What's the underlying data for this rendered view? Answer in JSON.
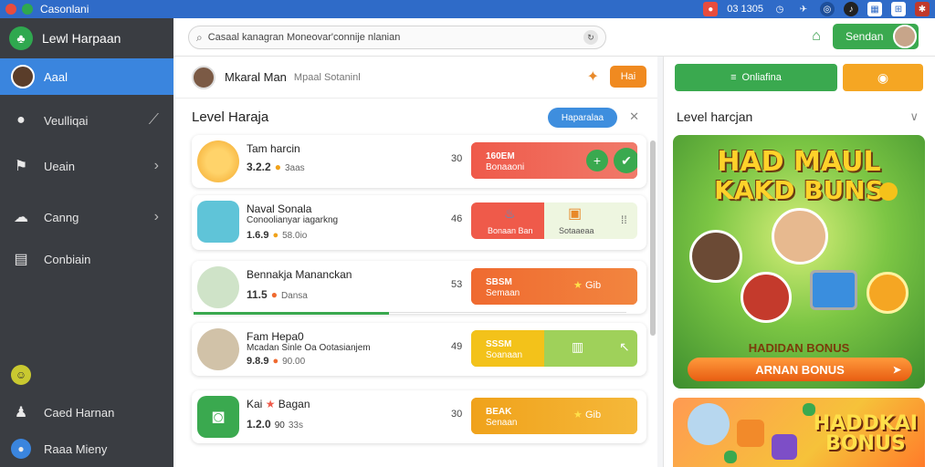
{
  "titlebar": {
    "title": "Casonlani",
    "time": "03 1305"
  },
  "sidebar": {
    "title": "Lewl Harpaan",
    "items": [
      {
        "label": "Aaal",
        "icon": "avatar"
      },
      {
        "label": "Veulliqai",
        "icon": "apple-icon"
      },
      {
        "label": "Ueain",
        "icon": "flag-icon"
      },
      {
        "label": "Canng",
        "icon": "cloud-icon"
      },
      {
        "label": "Conbiain",
        "icon": "document-icon"
      }
    ],
    "bottom": [
      {
        "label": "Caed Harnan",
        "icon": "user-icon"
      },
      {
        "label": "Raaa Mieny",
        "icon": "globe-icon"
      }
    ]
  },
  "topbar": {
    "search_value": "Casaal kanagran Moneovar'connije nlanian",
    "send_label": "Sendan"
  },
  "profile": {
    "name": "Mkaral Man",
    "subtitle": "Mpaal Sotaninl",
    "button": "Hai"
  },
  "list": {
    "title": "Level Haraja",
    "button": "Haparalaa",
    "rows": [
      {
        "name": "Tam harcin",
        "sub": "",
        "stat": "3.2.2",
        "small": "3aas",
        "num": "30",
        "p1": "160EM",
        "p2": "Bonaaoni",
        "color": "#ef5a4a",
        "fill": 0.7,
        "act": "+",
        "act2": "check"
      },
      {
        "name": "Naval Sonala",
        "sub": "Conoolianyar iagarkng",
        "stat": "1.6.9",
        "small": "58.0io",
        "num": "46",
        "p1": "",
        "p2": "Bonaan Ban",
        "color": "#ef5a4a",
        "fill": 0.45,
        "mid": "Sotaaeaa",
        "act": "",
        "act2": ""
      },
      {
        "name": "Bennakja Mananckan",
        "sub": "",
        "stat": "11.5",
        "small": "Dansa",
        "num": "53",
        "p1": "SBSM",
        "p2": "Semaan",
        "color": "#ef6a30",
        "fill": 0.9,
        "mid": "Gib",
        "act": "",
        "act2": ""
      },
      {
        "name": "Fam Hepa0",
        "sub": "Mcadan Sinle Oa Ootasianjem",
        "stat": "9.8.9",
        "small": "90.00",
        "num": "49",
        "p1": "SSSM",
        "p2": "Soanaan",
        "color": "#f3c21a",
        "fill": 0.45,
        "mid": "",
        "act": "",
        "act2": ""
      },
      {
        "name": "Kai",
        "sub": "Bagan",
        "stat": "1.2.0",
        "small": "33s",
        "num": "30",
        "p1": "BEAK",
        "p2": "Senaan",
        "color": "#f0a21b",
        "fill": 0.9,
        "mid": "Gib",
        "act": "",
        "act2": ""
      }
    ]
  },
  "right": {
    "green_btn": "Onliafina",
    "heading": "Level harcjan",
    "promo1": {
      "title1": "HAD MAUL",
      "title2": "KAKD BUNS",
      "sub": "HADIDAN BONUS",
      "cta": "ARNAN BONUS"
    },
    "promo2": {
      "title1": "HADDKAI",
      "title2": "BONUS"
    }
  }
}
